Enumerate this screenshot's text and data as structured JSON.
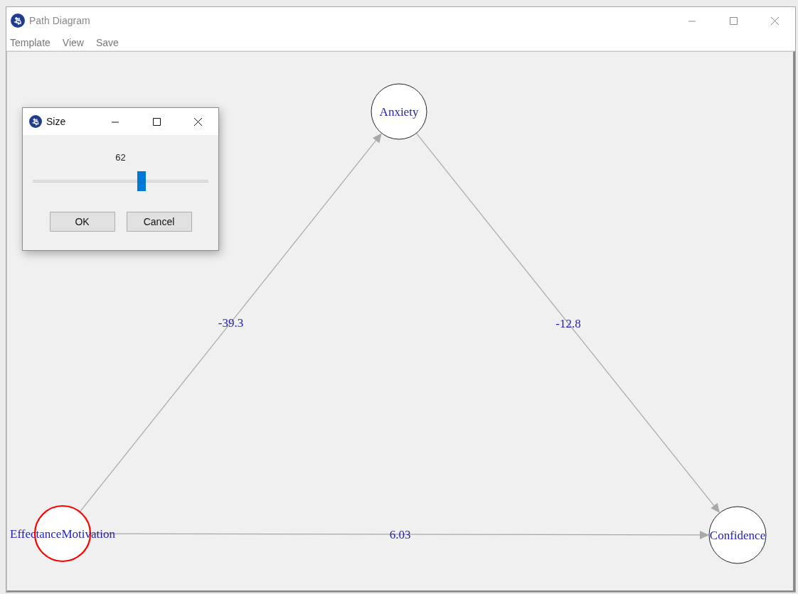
{
  "window": {
    "title": "Path Diagram"
  },
  "menu": [
    "Template",
    "View",
    "Save"
  ],
  "diagram": {
    "nodes": [
      {
        "label": "Anxiety",
        "selected": false
      },
      {
        "label": "EffectanceMotivation",
        "selected": true
      },
      {
        "label": "Confidence",
        "selected": false
      }
    ],
    "edges": [
      {
        "label": "-39.3"
      },
      {
        "label": "-12.8"
      },
      {
        "label": "6.03"
      }
    ]
  },
  "dialog": {
    "title": "Size",
    "value": "62",
    "slider": {
      "level": 0.62
    },
    "buttons": [
      "OK",
      "Cancel"
    ]
  }
}
